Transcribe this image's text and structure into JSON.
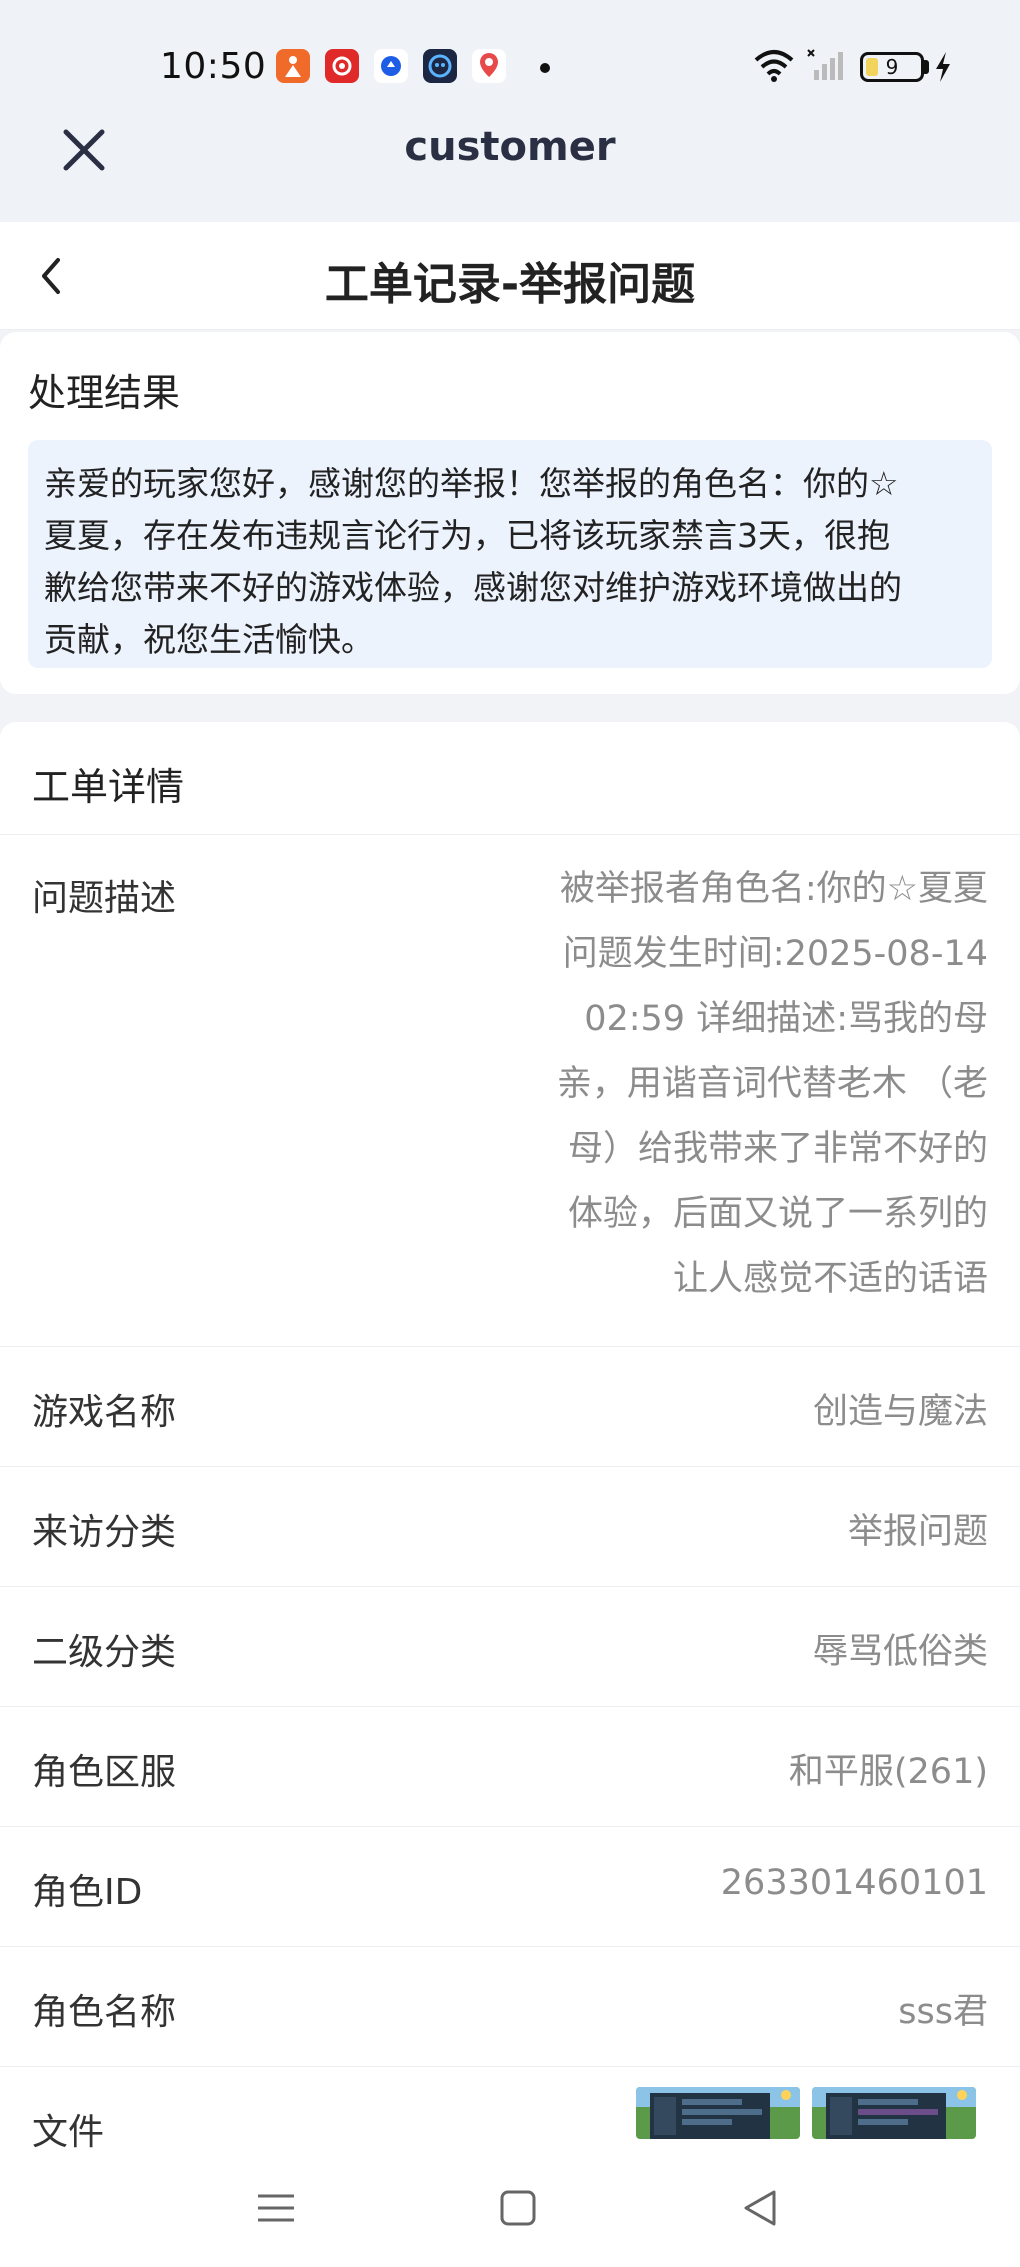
{
  "status_bar": {
    "time": "10:50",
    "battery": "9",
    "apps": [
      {
        "name": "app-orange-icon",
        "color": "#f06a2a"
      },
      {
        "name": "app-netease-music-icon",
        "color": "#e02a2a"
      },
      {
        "name": "app-blue-circle-icon",
        "color": "#1e5ee6"
      },
      {
        "name": "app-dark-robot-icon",
        "color": "#1c2744"
      },
      {
        "name": "app-map-pin-icon",
        "color": "#e84a4a"
      }
    ]
  },
  "app_header": {
    "title": "customer"
  },
  "page_nav": {
    "title": "工单记录-举报问题"
  },
  "result": {
    "heading": "处理结果",
    "lines": [
      "亲爱的玩家您好，感谢您的举报！您举报的角色名：你的☆",
      "夏夏，存在发布违规言论行为，已将该玩家禁言3天，很抱",
      "歉给您带来不好的游戏体验，感谢您对维护游戏环境做出的",
      "贡献，祝您生活愉快。"
    ]
  },
  "details": {
    "heading": "工单详情",
    "description": {
      "label": "问题描述",
      "lines": [
        "被举报者角色名:你的☆夏夏",
        "问题发生时间:2025-08-14",
        "02:59 详细描述:骂我的母",
        "亲，用谐音词代替老木 （老",
        "母）给我带来了非常不好的",
        "体验，后面又说了一系列的",
        "让人感觉不适的话语"
      ]
    },
    "rows": [
      {
        "label": "游戏名称",
        "value": "创造与魔法"
      },
      {
        "label": "来访分类",
        "value": "举报问题"
      },
      {
        "label": "二级分类",
        "value": "辱骂低俗类"
      },
      {
        "label": "角色区服",
        "value": "和平服(261)"
      },
      {
        "label": "角色ID",
        "value": "263301460101"
      },
      {
        "label": "角色名称",
        "value": "sss君"
      }
    ],
    "files": {
      "label": "文件"
    }
  },
  "colors": {
    "accent_bg": "#edf3fd",
    "header_text": "#2b2f44",
    "value_text": "#8c8c8c"
  }
}
